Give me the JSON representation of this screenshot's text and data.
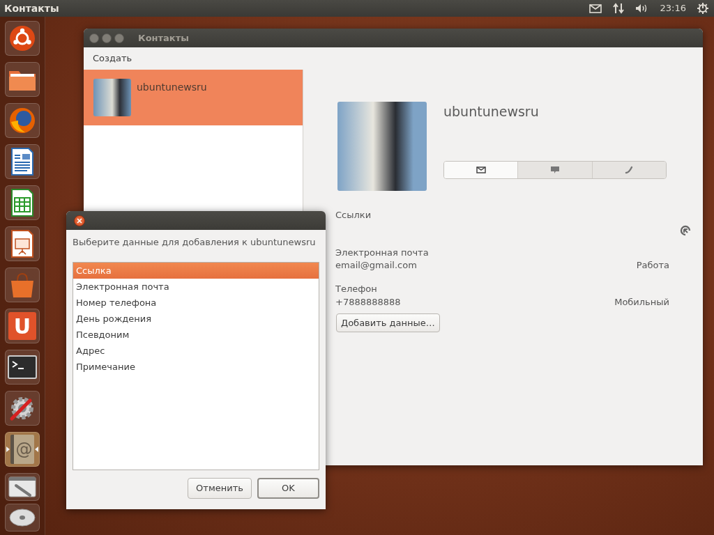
{
  "top_panel": {
    "app_title": "Контакты",
    "clock": "23:16"
  },
  "launcher": {
    "items": [
      {
        "kind": "ubuntu",
        "active": false
      },
      {
        "kind": "folder",
        "active": false
      },
      {
        "kind": "browser",
        "active": false
      },
      {
        "kind": "document",
        "active": false
      },
      {
        "kind": "spreadsheet",
        "active": false
      },
      {
        "kind": "presentation",
        "active": false
      },
      {
        "kind": "bag",
        "active": false
      },
      {
        "kind": "letter",
        "glyph": "U",
        "active": false
      },
      {
        "kind": "terminal",
        "active": false
      },
      {
        "kind": "settings",
        "active": false
      },
      {
        "kind": "contacts",
        "glyph": "@",
        "active": true
      },
      {
        "kind": "tools",
        "active": false
      },
      {
        "kind": "disc",
        "active": false
      }
    ]
  },
  "main_window": {
    "title": "Контакты",
    "menu": [
      "Создать"
    ],
    "contacts": [
      {
        "name": "ubuntunewsru",
        "selected": true
      }
    ],
    "detail": {
      "name": "ubuntunewsru",
      "action_tabs": [
        {
          "kind": "email",
          "selected": true
        },
        {
          "kind": "chat",
          "selected": false
        },
        {
          "kind": "phone",
          "selected": false
        }
      ],
      "links_label": "Ссылки",
      "fields": [
        {
          "label": "Электронная почта",
          "value": "email@gmail.com",
          "type": "Работа"
        },
        {
          "label": "Телефон",
          "value": "+7888888888",
          "type": "Мобильный"
        }
      ],
      "add_button": "Добавить данные…"
    }
  },
  "dialog": {
    "prompt": "Выберите данные для добавления к ubuntunewsru",
    "options": [
      {
        "label": "Ссылка",
        "selected": true
      },
      {
        "label": "Электронная почта",
        "selected": false
      },
      {
        "label": "Номер телефона",
        "selected": false
      },
      {
        "label": "День рождения",
        "selected": false
      },
      {
        "label": "Псевдоним",
        "selected": false
      },
      {
        "label": "Адрес",
        "selected": false
      },
      {
        "label": "Примечание",
        "selected": false
      }
    ],
    "buttons": [
      {
        "label": "Отменить",
        "default": false
      },
      {
        "label": "OK",
        "default": true
      }
    ]
  }
}
